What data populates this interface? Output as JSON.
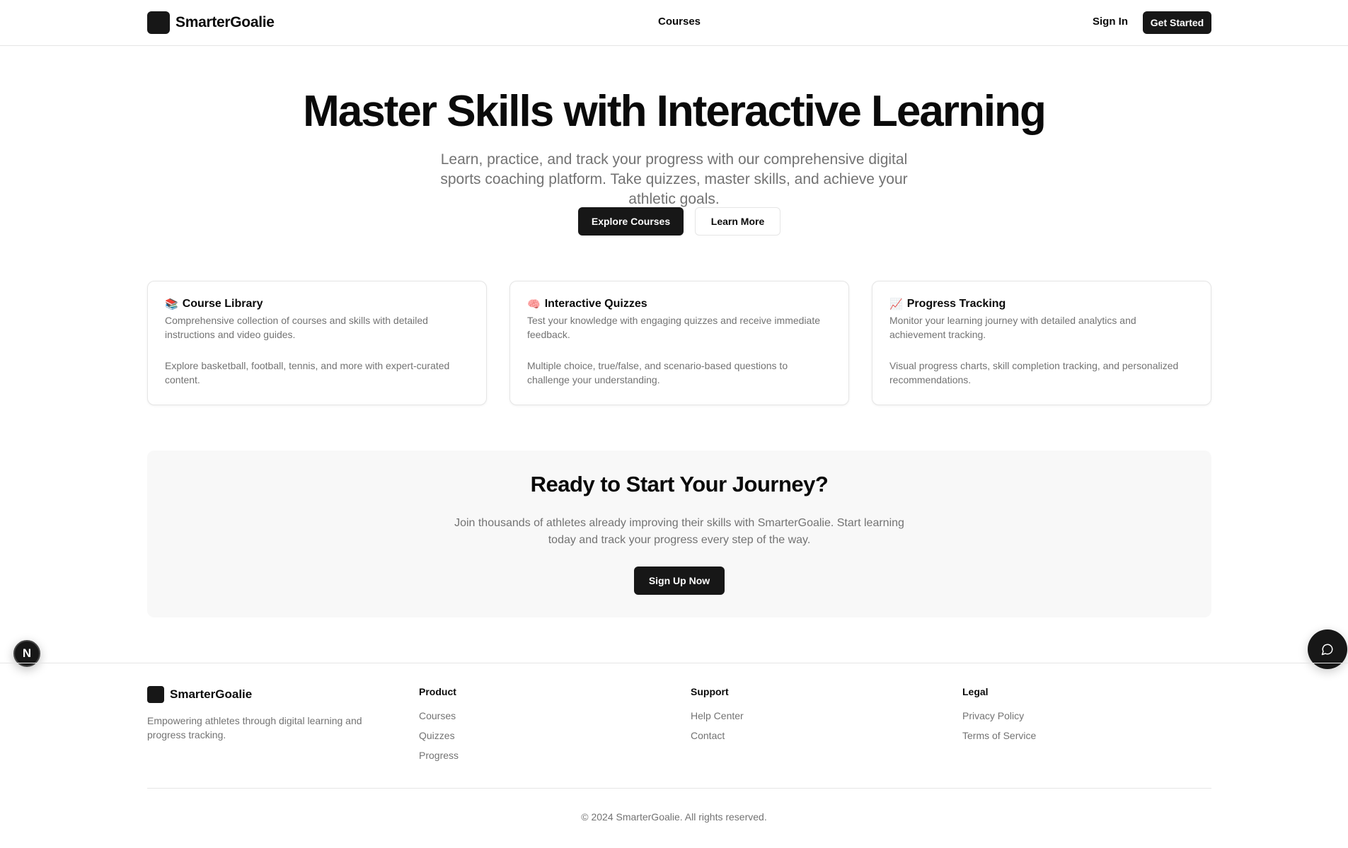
{
  "header": {
    "brand": "SmarterGoalie",
    "nav_courses": "Courses",
    "sign_in": "Sign In",
    "get_started": "Get Started"
  },
  "hero": {
    "title": "Master Skills with Interactive Learning",
    "subtitle": "Learn, practice, and track your progress with our comprehensive digital sports coaching platform. Take quizzes, master skills, and achieve your athletic goals.",
    "primary_button": "Explore Courses",
    "secondary_button": "Learn More"
  },
  "features": [
    {
      "icon": "📚",
      "title": "Course Library",
      "description": "Comprehensive collection of courses and skills with detailed instructions and video guides.",
      "detail": "Explore basketball, football, tennis, and more with expert-curated content."
    },
    {
      "icon": "🧠",
      "title": "Interactive Quizzes",
      "description": "Test your knowledge with engaging quizzes and receive immediate feedback.",
      "detail": "Multiple choice, true/false, and scenario-based questions to challenge your understanding."
    },
    {
      "icon": "📈",
      "title": "Progress Tracking",
      "description": "Monitor your learning journey with detailed analytics and achievement tracking.",
      "detail": "Visual progress charts, skill completion tracking, and personalized recommendations."
    }
  ],
  "cta": {
    "title": "Ready to Start Your Journey?",
    "text": "Join thousands of athletes already improving their skills with SmarterGoalie. Start learning today and track your progress every step of the way.",
    "button": "Sign Up Now"
  },
  "floating": {
    "next_badge": "N"
  },
  "footer": {
    "brand": "SmarterGoalie",
    "tagline": "Empowering athletes through digital learning and progress tracking.",
    "product": {
      "heading": "Product",
      "links": [
        "Courses",
        "Quizzes",
        "Progress"
      ]
    },
    "support": {
      "heading": "Support",
      "links": [
        "Help Center",
        "Contact"
      ]
    },
    "legal": {
      "heading": "Legal",
      "links": [
        "Privacy Policy",
        "Terms of Service"
      ]
    },
    "copyright": "© 2024 SmarterGoalie. All rights reserved."
  },
  "colors": {
    "primary": "#171717",
    "muted_text": "#737373",
    "border": "#e5e5e5",
    "cta_background": "#f8f8f8"
  }
}
